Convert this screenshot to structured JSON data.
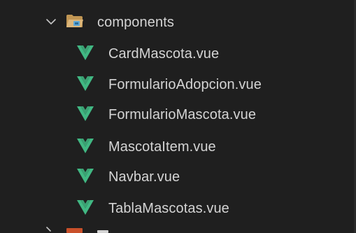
{
  "folder": {
    "name": "components",
    "expanded": true,
    "icon": "folder-open-icon",
    "icon_color": "#c09553"
  },
  "files": [
    {
      "name": "CardMascota.vue",
      "icon": "vue-icon"
    },
    {
      "name": "FormularioAdopcion.vue",
      "icon": "vue-icon"
    },
    {
      "name": "FormularioMascota.vue",
      "icon": "vue-icon"
    },
    {
      "name": "MascotaItem.vue",
      "icon": "vue-icon"
    },
    {
      "name": "Navbar.vue",
      "icon": "vue-icon"
    },
    {
      "name": "TablaMascotas.vue",
      "icon": "vue-icon"
    }
  ],
  "colors": {
    "background": "#1f1f1f",
    "text": "#d4d4d4",
    "vue_green": "#41b883"
  }
}
